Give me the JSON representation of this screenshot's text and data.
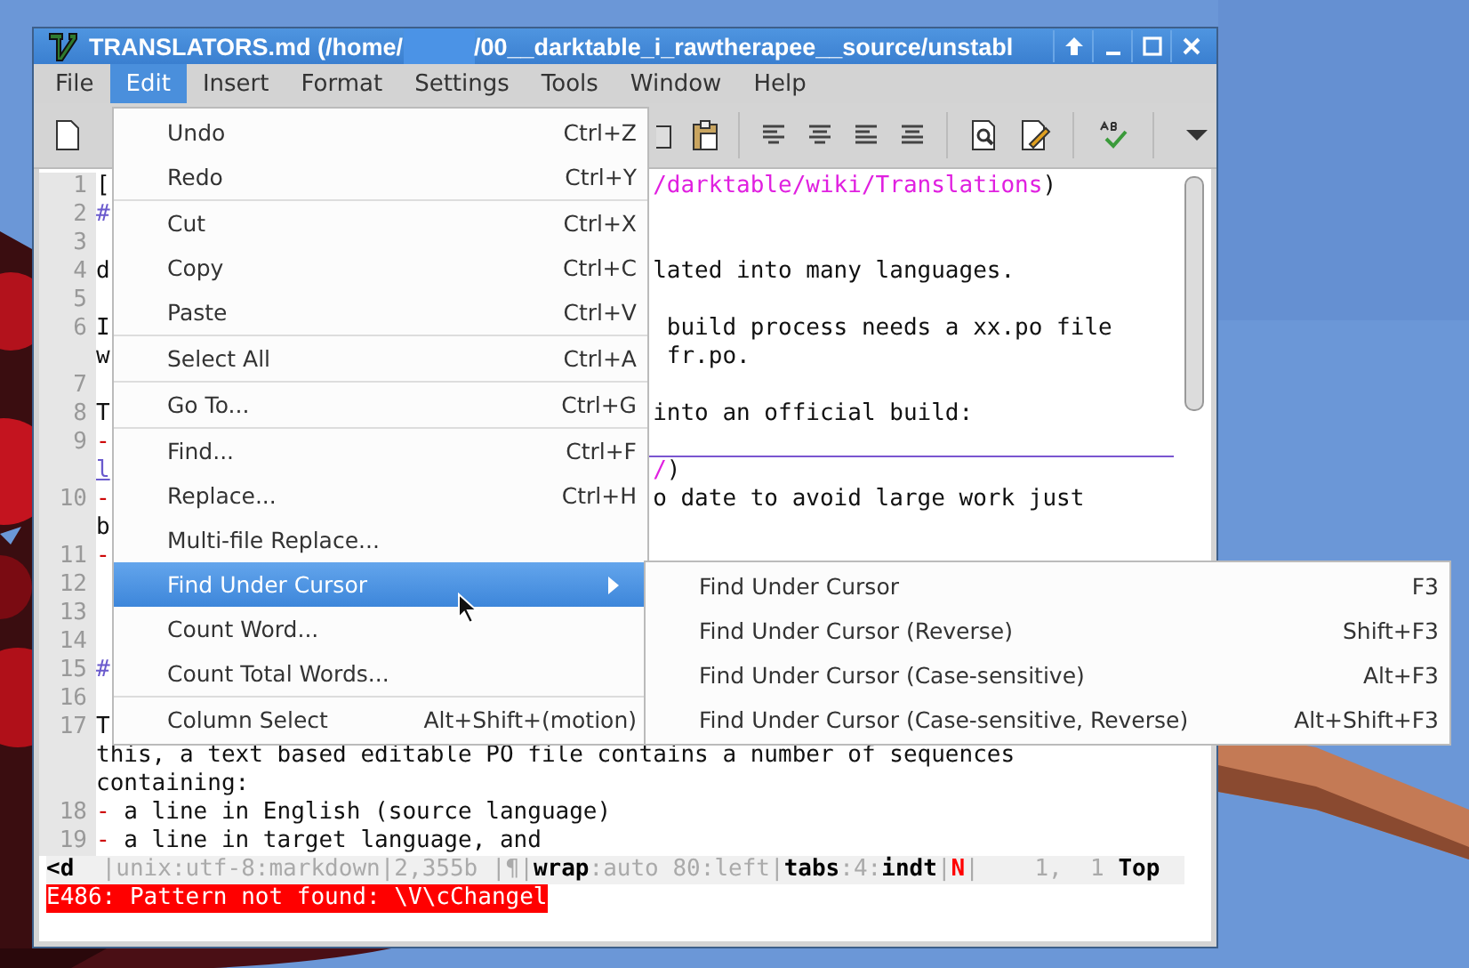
{
  "window": {
    "title_parts": [
      "TRANSLATORS.md (/home/",
      "/00__darktable_i_rawtherapee__source/unstabl"
    ]
  },
  "menubar": [
    {
      "label": "File",
      "selected": false
    },
    {
      "label": "Edit",
      "selected": true
    },
    {
      "label": "Insert",
      "selected": false
    },
    {
      "label": "Format",
      "selected": false
    },
    {
      "label": "Settings",
      "selected": false
    },
    {
      "label": "Tools",
      "selected": false
    },
    {
      "label": "Window",
      "selected": false
    },
    {
      "label": "Help",
      "selected": false
    }
  ],
  "editor_lines": [
    {
      "number": "1",
      "left": [
        {
          "kind": "plain",
          "text": "["
        }
      ],
      "right": [
        {
          "kind": "link",
          "text": "/darktable/wiki/Translations"
        },
        {
          "kind": "plain",
          "text": ")"
        }
      ]
    },
    {
      "number": "2",
      "left": [
        {
          "kind": "heading",
          "text": "#"
        }
      ]
    },
    {
      "number": "3"
    },
    {
      "number": "4",
      "left": [
        {
          "kind": "plain",
          "text": "d"
        }
      ],
      "right": [
        {
          "kind": "plain",
          "text": "lated into many languages."
        }
      ]
    },
    {
      "number": "5"
    },
    {
      "number": "6",
      "left": [
        {
          "kind": "plain",
          "text": "I"
        }
      ],
      "right": [
        {
          "kind": "plain",
          "text": " build process needs a xx.po file"
        }
      ]
    },
    {
      "left": [
        {
          "kind": "plain",
          "text": "w"
        }
      ],
      "right": [
        {
          "kind": "plain",
          "text": " fr.po."
        }
      ]
    },
    {
      "number": "7"
    },
    {
      "number": "8",
      "left": [
        {
          "kind": "plain",
          "text": "T"
        }
      ],
      "right": [
        {
          "kind": "plain",
          "text": "into an official build:"
        }
      ]
    },
    {
      "number": "9",
      "left": [
        {
          "kind": "bullet",
          "text": "-"
        }
      ],
      "underlined": true
    },
    {
      "left": [
        {
          "kind": "underlined",
          "text": "l"
        }
      ],
      "right": [
        {
          "kind": "link",
          "text": "/"
        },
        {
          "kind": "plain",
          "text": ")"
        }
      ]
    },
    {
      "number": "10",
      "left": [
        {
          "kind": "bullet",
          "text": "-"
        }
      ],
      "right": [
        {
          "kind": "plain",
          "text": "o date to avoid large work just"
        }
      ]
    },
    {
      "left": [
        {
          "kind": "plain",
          "text": "b"
        }
      ]
    },
    {
      "number": "11",
      "left": [
        {
          "kind": "bullet",
          "text": "-"
        }
      ]
    },
    {
      "number": "12"
    },
    {
      "number": "13"
    },
    {
      "number": "14"
    },
    {
      "number": "15",
      "left": [
        {
          "kind": "heading",
          "text": "#"
        }
      ]
    },
    {
      "number": "16"
    },
    {
      "number": "17",
      "left": [
        {
          "kind": "plain",
          "text": "T"
        }
      ]
    },
    {
      "left": [
        {
          "kind": "plain",
          "text": "this, a text based editable PO file contains a number of sequences"
        }
      ]
    },
    {
      "left": [
        {
          "kind": "plain",
          "text": "containing:"
        }
      ]
    },
    {
      "number": "18",
      "left": [
        {
          "kind": "bullet",
          "text": "-"
        },
        {
          "kind": "plain",
          "text": " a line in English (source language)"
        }
      ]
    },
    {
      "number": "19",
      "left": [
        {
          "kind": "bullet",
          "text": "-"
        },
        {
          "kind": "plain",
          "text": " a line in target language, and"
        }
      ]
    }
  ],
  "status_line": [
    {
      "kind": "bold",
      "text": "<d"
    },
    {
      "kind": "dim",
      "text": "  |unix:utf-8:markdown|2,355b |¶|"
    },
    {
      "kind": "bold",
      "text": "wrap"
    },
    {
      "kind": "dim",
      "text": ":auto 80:left|"
    },
    {
      "kind": "bold",
      "text": "tabs"
    },
    {
      "kind": "dim",
      "text": ":4:"
    },
    {
      "kind": "bold",
      "text": "indt"
    },
    {
      "kind": "dim",
      "text": "|"
    },
    {
      "kind": "alert",
      "text": "N"
    },
    {
      "kind": "dim",
      "text": "|    1,  1 "
    },
    {
      "kind": "bold",
      "text": "Top"
    }
  ],
  "message_line": "E486: Pattern not found: \\V\\cChangel",
  "edit_menu": [
    {
      "label": "Undo",
      "shortcut": "Ctrl+Z",
      "separator_before": false,
      "selected": false,
      "has_submenu": false
    },
    {
      "label": "Redo",
      "shortcut": "Ctrl+Y",
      "separator_before": false,
      "selected": false,
      "has_submenu": false
    },
    {
      "label": "Cut",
      "shortcut": "Ctrl+X",
      "separator_before": true,
      "selected": false,
      "has_submenu": false
    },
    {
      "label": "Copy",
      "shortcut": "Ctrl+C",
      "separator_before": false,
      "selected": false,
      "has_submenu": false
    },
    {
      "label": "Paste",
      "shortcut": "Ctrl+V",
      "separator_before": false,
      "selected": false,
      "has_submenu": false
    },
    {
      "label": "Select All",
      "shortcut": "Ctrl+A",
      "separator_before": true,
      "selected": false,
      "has_submenu": false
    },
    {
      "label": "Go To...",
      "shortcut": "Ctrl+G",
      "separator_before": true,
      "selected": false,
      "has_submenu": false
    },
    {
      "label": "Find...",
      "shortcut": "Ctrl+F",
      "separator_before": true,
      "selected": false,
      "has_submenu": false
    },
    {
      "label": "Replace...",
      "shortcut": "Ctrl+H",
      "separator_before": false,
      "selected": false,
      "has_submenu": false
    },
    {
      "label": "Multi-file Replace...",
      "separator_before": false,
      "selected": false,
      "has_submenu": false
    },
    {
      "label": "Find Under Cursor",
      "separator_before": false,
      "selected": true,
      "has_submenu": true
    },
    {
      "label": "Count Word...",
      "separator_before": false,
      "selected": false,
      "has_submenu": false
    },
    {
      "label": "Count Total Words...",
      "separator_before": false,
      "selected": false,
      "has_submenu": false
    },
    {
      "label": "Column Select",
      "shortcut": "Alt+Shift+(motion)",
      "separator_before": true,
      "selected": false,
      "has_submenu": false
    }
  ],
  "submenu": [
    {
      "label": "Find Under Cursor",
      "shortcut": "F3"
    },
    {
      "label": "Find Under Cursor (Reverse)",
      "shortcut": "Shift+F3"
    },
    {
      "label": "Find Under Cursor (Case-sensitive)",
      "shortcut": "Alt+F3"
    },
    {
      "label": "Find Under Cursor (Case-sensitive, Reverse)",
      "shortcut": "Alt+Shift+F3"
    }
  ]
}
